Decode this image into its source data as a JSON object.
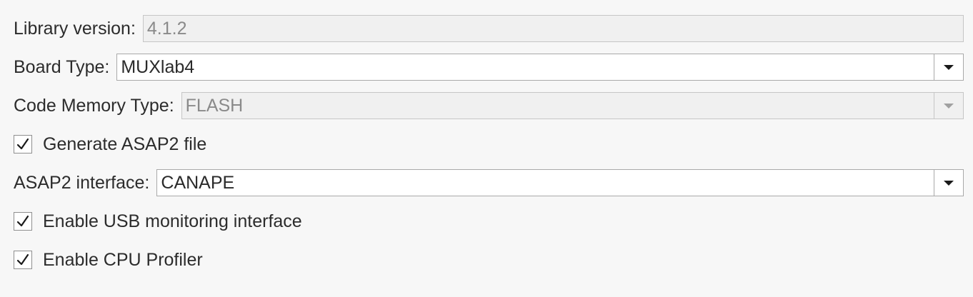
{
  "library_version": {
    "label": "Library version:",
    "value": "4.1.2"
  },
  "board_type": {
    "label": "Board Type:",
    "value": "MUXlab4"
  },
  "code_memory_type": {
    "label": "Code Memory Type:",
    "value": "FLASH"
  },
  "generate_asap2": {
    "label": "Generate ASAP2 file",
    "checked": true
  },
  "asap2_interface": {
    "label": "ASAP2 interface:",
    "value": "CANAPE"
  },
  "enable_usb_monitoring": {
    "label": "Enable USB monitoring interface",
    "checked": true
  },
  "enable_cpu_profiler": {
    "label": "Enable CPU Profiler",
    "checked": true
  },
  "icons": {
    "checkbox": "checkmark-icon",
    "dropdown": "chevron-down-icon"
  }
}
